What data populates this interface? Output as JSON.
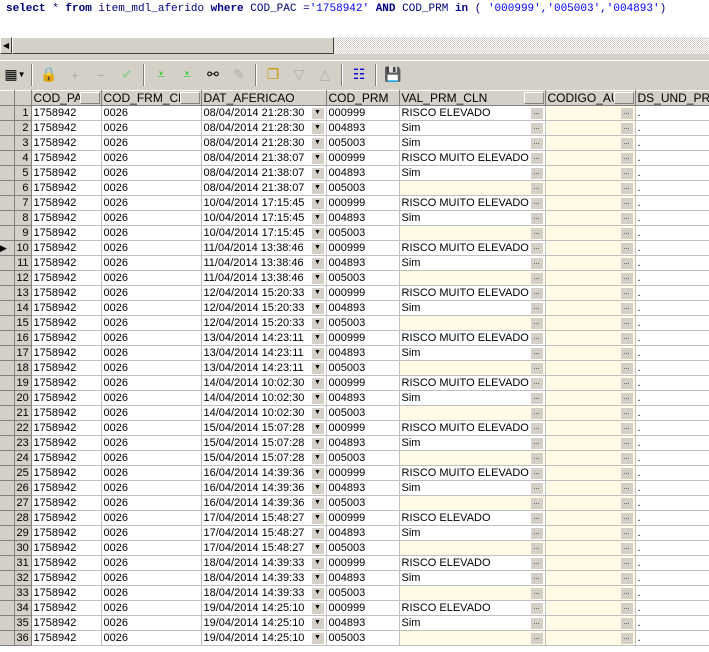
{
  "query": {
    "kw_select": "select",
    "star": " * ",
    "kw_from": "from",
    "table": " item_mdl_aferido ",
    "kw_where": "where",
    "cond1": " COD_PAC =",
    "val1": "'1758942'",
    "kw_and": " AND ",
    "cond2": "COD_PRM ",
    "kw_in": "in",
    "open": " ( ",
    "vals": "'000999','005003','004893'",
    "close": ")"
  },
  "toolbar": {
    "icons": [
      "grid-icon",
      "lock-icon",
      "plus-icon",
      "minus-icon",
      "check-icon",
      "filter-down-icon",
      "filter-all-icon",
      "binoculars-icon",
      "eraser-icon",
      "copy-icon",
      "triangle-down-icon",
      "triangle-up-icon",
      "tree-icon",
      "save-icon"
    ]
  },
  "columns": [
    "COD_PAC",
    "COD_FRM_CLN",
    "DAT_AFERICAO",
    "COD_PRM",
    "VAL_PRM_CLN",
    "CODIGO_AUX",
    "DS_UND_PRM"
  ],
  "current_row": 10,
  "rows": [
    [
      "1",
      "1758942",
      "0026",
      "08/04/2014 21:28:30",
      "000999",
      "RISCO ELEVADO",
      "",
      "."
    ],
    [
      "2",
      "1758942",
      "0026",
      "08/04/2014 21:28:30",
      "004893",
      "Sim",
      "",
      "."
    ],
    [
      "3",
      "1758942",
      "0026",
      "08/04/2014 21:28:30",
      "005003",
      "Sim",
      "",
      "."
    ],
    [
      "4",
      "1758942",
      "0026",
      "08/04/2014 21:38:07",
      "000999",
      "RISCO MUITO ELEVADO",
      "",
      "."
    ],
    [
      "5",
      "1758942",
      "0026",
      "08/04/2014 21:38:07",
      "004893",
      "Sim",
      "",
      "."
    ],
    [
      "6",
      "1758942",
      "0026",
      "08/04/2014 21:38:07",
      "005003",
      "",
      "",
      "."
    ],
    [
      "7",
      "1758942",
      "0026",
      "10/04/2014 17:15:45",
      "000999",
      "RISCO MUITO ELEVADO",
      "",
      "."
    ],
    [
      "8",
      "1758942",
      "0026",
      "10/04/2014 17:15:45",
      "004893",
      "Sim",
      "",
      "."
    ],
    [
      "9",
      "1758942",
      "0026",
      "10/04/2014 17:15:45",
      "005003",
      "",
      "",
      "."
    ],
    [
      "10",
      "1758942",
      "0026",
      "11/04/2014 13:38:46",
      "000999",
      "RISCO MUITO ELEVADO",
      "",
      "."
    ],
    [
      "11",
      "1758942",
      "0026",
      "11/04/2014 13:38:46",
      "004893",
      "Sim",
      "",
      "."
    ],
    [
      "12",
      "1758942",
      "0026",
      "11/04/2014 13:38:46",
      "005003",
      "",
      "",
      "."
    ],
    [
      "13",
      "1758942",
      "0026",
      "12/04/2014 15:20:33",
      "000999",
      "RISCO MUITO ELEVADO",
      "",
      "."
    ],
    [
      "14",
      "1758942",
      "0026",
      "12/04/2014 15:20:33",
      "004893",
      "Sim",
      "",
      "."
    ],
    [
      "15",
      "1758942",
      "0026",
      "12/04/2014 15:20:33",
      "005003",
      "",
      "",
      "."
    ],
    [
      "16",
      "1758942",
      "0026",
      "13/04/2014 14:23:11",
      "000999",
      "RISCO MUITO ELEVADO",
      "",
      "."
    ],
    [
      "17",
      "1758942",
      "0026",
      "13/04/2014 14:23:11",
      "004893",
      "Sim",
      "",
      "."
    ],
    [
      "18",
      "1758942",
      "0026",
      "13/04/2014 14:23:11",
      "005003",
      "",
      "",
      "."
    ],
    [
      "19",
      "1758942",
      "0026",
      "14/04/2014 10:02:30",
      "000999",
      "RISCO MUITO ELEVADO",
      "",
      "."
    ],
    [
      "20",
      "1758942",
      "0026",
      "14/04/2014 10:02:30",
      "004893",
      "Sim",
      "",
      "."
    ],
    [
      "21",
      "1758942",
      "0026",
      "14/04/2014 10:02:30",
      "005003",
      "",
      "",
      "."
    ],
    [
      "22",
      "1758942",
      "0026",
      "15/04/2014 15:07:28",
      "000999",
      "RISCO MUITO ELEVADO",
      "",
      "."
    ],
    [
      "23",
      "1758942",
      "0026",
      "15/04/2014 15:07:28",
      "004893",
      "Sim",
      "",
      "."
    ],
    [
      "24",
      "1758942",
      "0026",
      "15/04/2014 15:07:28",
      "005003",
      "",
      "",
      "."
    ],
    [
      "25",
      "1758942",
      "0026",
      "16/04/2014 14:39:36",
      "000999",
      "RISCO MUITO ELEVADO",
      "",
      "."
    ],
    [
      "26",
      "1758942",
      "0026",
      "16/04/2014 14:39:36",
      "004893",
      "Sim",
      "",
      "."
    ],
    [
      "27",
      "1758942",
      "0026",
      "16/04/2014 14:39:36",
      "005003",
      "",
      "",
      "."
    ],
    [
      "28",
      "1758942",
      "0026",
      "17/04/2014 15:48:27",
      "000999",
      "RISCO ELEVADO",
      "",
      "."
    ],
    [
      "29",
      "1758942",
      "0026",
      "17/04/2014 15:48:27",
      "004893",
      "Sim",
      "",
      "."
    ],
    [
      "30",
      "1758942",
      "0026",
      "17/04/2014 15:48:27",
      "005003",
      "",
      "",
      "."
    ],
    [
      "31",
      "1758942",
      "0026",
      "18/04/2014 14:39:33",
      "000999",
      "RISCO ELEVADO",
      "",
      "."
    ],
    [
      "32",
      "1758942",
      "0026",
      "18/04/2014 14:39:33",
      "004893",
      "Sim",
      "",
      "."
    ],
    [
      "33",
      "1758942",
      "0026",
      "18/04/2014 14:39:33",
      "005003",
      "",
      "",
      "."
    ],
    [
      "34",
      "1758942",
      "0026",
      "19/04/2014 14:25:10",
      "000999",
      "RISCO ELEVADO",
      "",
      "."
    ],
    [
      "35",
      "1758942",
      "0026",
      "19/04/2014 14:25:10",
      "004893",
      "Sim",
      "",
      "."
    ],
    [
      "36",
      "1758942",
      "0026",
      "19/04/2014 14:25:10",
      "005003",
      "",
      "",
      "."
    ]
  ],
  "ellipsis": "...",
  "colors": {
    "null_cell": "#fffbe6",
    "keyword": "#000080",
    "string": "#0000ff"
  }
}
